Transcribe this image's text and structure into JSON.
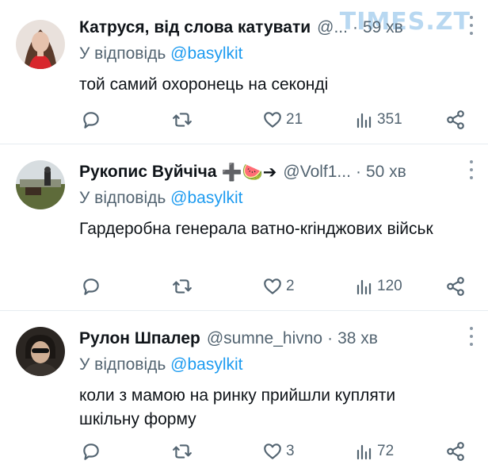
{
  "watermark": "TIMES.ZT",
  "tweets": [
    {
      "name": "Катруся, від слова катувати",
      "handle": "@...",
      "time": "59 хв",
      "reply_prefix": "У відповідь",
      "reply_to": "@basylkit",
      "text": "той самий охоронець на секонді",
      "likes": "21",
      "views": "351"
    },
    {
      "name": "Рукопис Вуйчіча",
      "name_emoji": "➕🍉➔",
      "handle": "@Volf1...",
      "time": "50 хв",
      "reply_prefix": "У відповідь",
      "reply_to": "@basylkit",
      "text": "Гардеробна генерала ватно-кrінджових військ",
      "likes": "2",
      "views": "120"
    },
    {
      "name": "Рулон Шпалер",
      "handle": "@sumne_hivno",
      "time": "38 хв",
      "reply_prefix": "У відповідь",
      "reply_to": "@basylkit",
      "text": "коли з мамою на ринку прийшли купляти шкільну форму",
      "likes": "3",
      "views": "72"
    }
  ],
  "icons": {
    "reply": "reply-icon",
    "retweet": "retweet-icon",
    "like": "heart-icon",
    "views": "views-icon",
    "share": "share-icon",
    "more": "more-dots-icon"
  },
  "colors": {
    "mention": "#1d9bf0",
    "secondary": "#536471",
    "primary_text": "#0f1419"
  }
}
